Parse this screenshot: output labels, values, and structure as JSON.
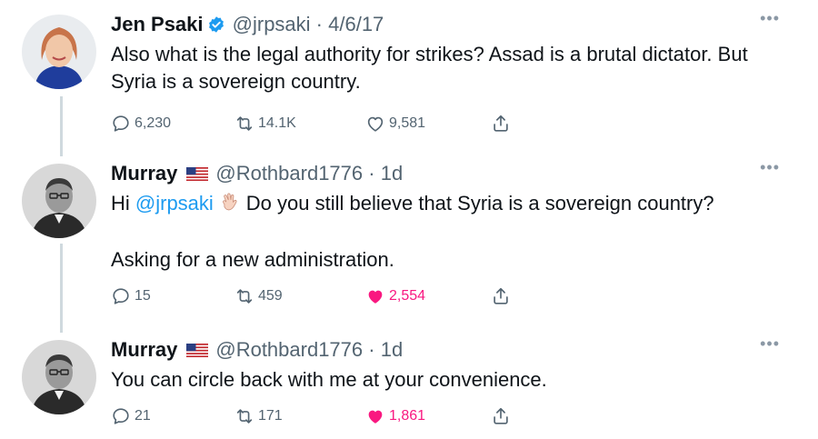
{
  "colors": {
    "accent": "#1d9bf0",
    "like": "#f91880",
    "muted": "#536471",
    "thread_line": "#cfd9de"
  },
  "tweets": [
    {
      "name": "Jen Psaki",
      "verified": true,
      "handle": "@jrpsaki",
      "separator": "·",
      "time": "4/6/17",
      "text": "Also what is the legal authority for strikes? Assad is a brutal dictator. But Syria is a sovereign country.",
      "replies": "6,230",
      "retweets": "14.1K",
      "likes": "9,581",
      "liked": false
    },
    {
      "name": "Murray",
      "flag": "us-flag-icon",
      "handle": "@Rothbard1776",
      "separator": "·",
      "time": "1d",
      "text_prefix": "Hi ",
      "mention": "@jrpsaki",
      "emoji": "waving-hand-icon",
      "text_suffix": "Do you still believe that Syria is a sovereign country?",
      "text_line2": "Asking for a new administration.",
      "replies": "15",
      "retweets": "459",
      "likes": "2,554",
      "liked": true
    },
    {
      "name": "Murray",
      "flag": "us-flag-icon",
      "handle": "@Rothbard1776",
      "separator": "·",
      "time": "1d",
      "text": "You can circle back with me at your convenience.",
      "replies": "21",
      "retweets": "171",
      "likes": "1,861",
      "liked": true
    }
  ]
}
